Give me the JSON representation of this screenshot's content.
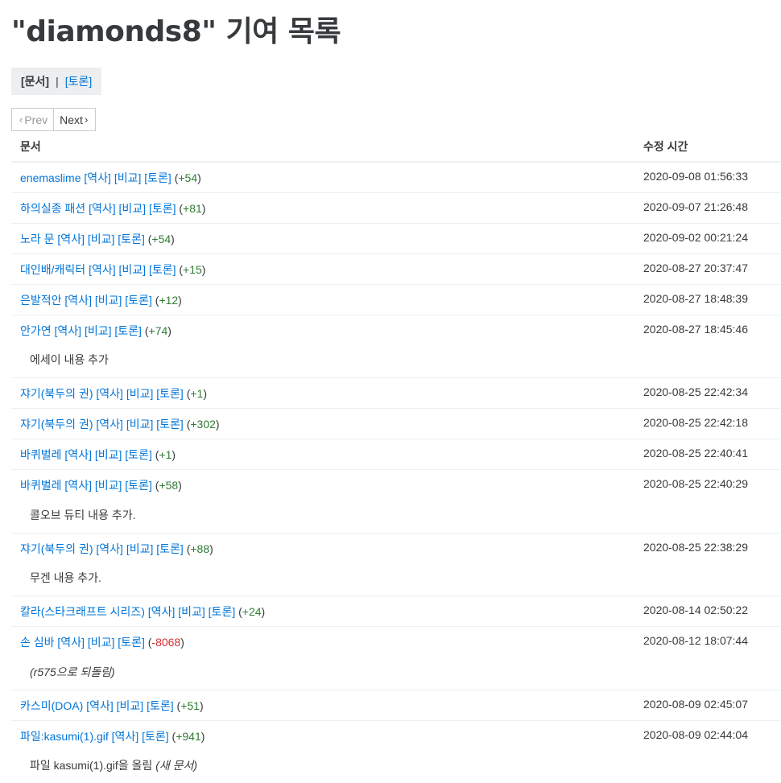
{
  "page": {
    "title": "\"diamonds8\" 기여 목록"
  },
  "tabs": {
    "active": "[문서]",
    "separator": "|",
    "discussion": "[토론]"
  },
  "pager": {
    "prev": "Prev",
    "next": "Next"
  },
  "table": {
    "col_doc": "문서",
    "col_time": "수정 시간"
  },
  "entries": [
    {
      "title": "enemaslime",
      "hist": "[역사]",
      "diff": "[비교]",
      "talk": "[토론]",
      "open": "(",
      "change": "+54",
      "close": ")",
      "time": "2020-09-08 01:56:33"
    },
    {
      "title": "하의실종 패션",
      "hist": "[역사]",
      "diff": "[비교]",
      "talk": "[토론]",
      "open": "(",
      "change": "+81",
      "close": ")",
      "time": "2020-09-07 21:26:48"
    },
    {
      "title": "노라 문",
      "hist": "[역사]",
      "diff": "[비교]",
      "talk": "[토론]",
      "open": "(",
      "change": "+54",
      "close": ")",
      "time": "2020-09-02 00:21:24"
    },
    {
      "title": "대인배/캐릭터",
      "hist": "[역사]",
      "diff": "[비교]",
      "talk": "[토론]",
      "open": "(",
      "change": "+15",
      "close": ")",
      "time": "2020-08-27 20:37:47"
    },
    {
      "title": "은발적안",
      "hist": "[역사]",
      "diff": "[비교]",
      "talk": "[토론]",
      "open": "(",
      "change": "+12",
      "close": ")",
      "time": "2020-08-27 18:48:39"
    },
    {
      "title": "안가연",
      "hist": "[역사]",
      "diff": "[비교]",
      "talk": "[토론]",
      "open": "(",
      "change": "+74",
      "close": ")",
      "time": "2020-08-27 18:45:46",
      "summary": "에세이 내용 추가"
    },
    {
      "title": "쟈기(북두의 권)",
      "hist": "[역사]",
      "diff": "[비교]",
      "talk": "[토론]",
      "open": "(",
      "change": "+1",
      "close": ")",
      "time": "2020-08-25 22:42:34"
    },
    {
      "title": "쟈기(북두의 권)",
      "hist": "[역사]",
      "diff": "[비교]",
      "talk": "[토론]",
      "open": "(",
      "change": "+302",
      "close": ")",
      "time": "2020-08-25 22:42:18"
    },
    {
      "title": "바퀴벌레",
      "hist": "[역사]",
      "diff": "[비교]",
      "talk": "[토론]",
      "open": "(",
      "change": "+1",
      "close": ")",
      "time": "2020-08-25 22:40:41"
    },
    {
      "title": "바퀴벌레",
      "hist": "[역사]",
      "diff": "[비교]",
      "talk": "[토론]",
      "open": "(",
      "change": "+58",
      "close": ")",
      "time": "2020-08-25 22:40:29",
      "summary": "콜오브 듀티 내용 추가."
    },
    {
      "title": "쟈기(북두의 권)",
      "hist": "[역사]",
      "diff": "[비교]",
      "talk": "[토론]",
      "open": "(",
      "change": "+88",
      "close": ")",
      "time": "2020-08-25 22:38:29",
      "summary": "무겐 내용 추가."
    },
    {
      "title": "칼라(스타크래프트 시리즈)",
      "hist": "[역사]",
      "diff": "[비교]",
      "talk": "[토론]",
      "open": "(",
      "change": "+24",
      "close": ")",
      "time": "2020-08-14 02:50:22"
    },
    {
      "title": "손 심바",
      "hist": "[역사]",
      "diff": "[비교]",
      "talk": "[토론]",
      "open": "(",
      "change": "-8068",
      "close": ")",
      "negative": true,
      "time": "2020-08-12 18:07:44",
      "summary_italic": "(r575으로 되돌림)"
    },
    {
      "title": "카스미(DOA)",
      "hist": "[역사]",
      "diff": "[비교]",
      "talk": "[토론]",
      "open": "(",
      "change": "+51",
      "close": ")",
      "time": "2020-08-09 02:45:07"
    },
    {
      "title": "파일:kasumi(1).gif",
      "hist": "[역사]",
      "talk": "[토론]",
      "open": "(",
      "change": "+941",
      "close": ")",
      "time": "2020-08-09 02:44:04",
      "summary": "파일 kasumi(1).gif을 올림",
      "summary_italic": "(새 문서)"
    }
  ],
  "colors": {
    "link": "#0275d8",
    "positive": "#2e7d32",
    "negative": "#d32f2f",
    "tab_bg": "#eceeef"
  },
  "icons": {
    "prev": "chevron-left-icon",
    "next": "chevron-right-icon"
  }
}
